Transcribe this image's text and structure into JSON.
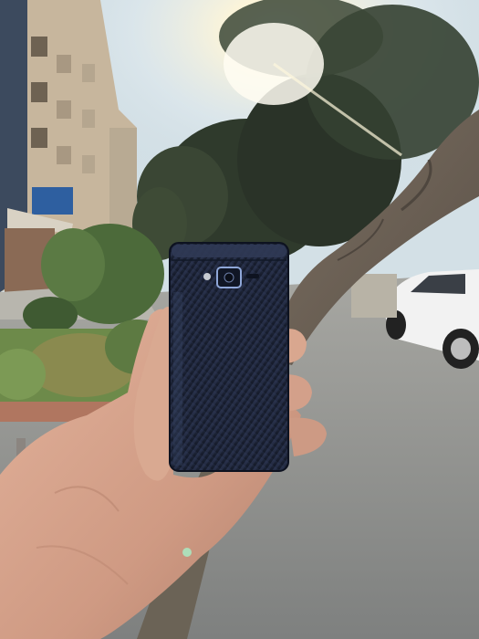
{
  "scene": {
    "description_label": "",
    "colors": {
      "sky": "#d9e6ee",
      "sun_glow": "#fffbe8",
      "building": "#c9b9a1",
      "building_shadow": "#8d8172",
      "trees_dark": "#2f3a2c",
      "foliage": "#4f6a3d",
      "ground": "#9a9a98",
      "trunk": "#6d6256",
      "car": "#f2f2f2",
      "phone_body": "#1e2638",
      "phone_texture": "#27314a",
      "skin": "#d8a58f",
      "skin_shadow": "#b78573"
    },
    "objects": [
      "apartment-building",
      "trees",
      "tree-trunk",
      "white-car",
      "flip-phone",
      "hand",
      "sun"
    ]
  }
}
